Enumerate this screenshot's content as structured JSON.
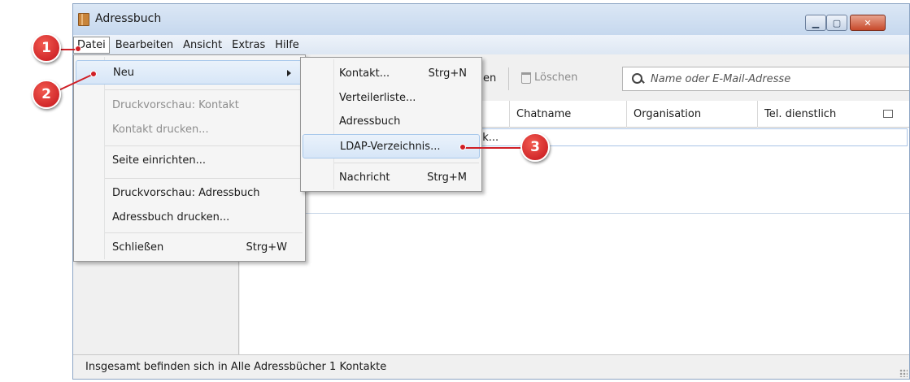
{
  "window": {
    "title": "Adressbuch",
    "controls": {
      "minimize": "▁",
      "maximize": "▢",
      "close": "✕"
    }
  },
  "menubar": [
    {
      "name": "menu-datei",
      "label": "Datei",
      "active": true
    },
    {
      "name": "menu-bearbeiten",
      "label": "Bearbeiten"
    },
    {
      "name": "menu-ansicht",
      "label": "Ansicht"
    },
    {
      "name": "menu-extras",
      "label": "Extras"
    },
    {
      "name": "menu-hilfe",
      "label": "Hilfe"
    }
  ],
  "toolbar": {
    "partial_label": "en",
    "delete_label": "Löschen",
    "search_placeholder": "Name oder E-Mail-Adresse"
  },
  "columns": [
    "Chatname",
    "Organisation",
    "Tel. dienstlich"
  ],
  "rows": [
    {
      "partial_text": "pk..."
    }
  ],
  "status": {
    "text": "Insgesamt befinden sich in Alle Adressbücher 1 Kontakte"
  },
  "datei_menu": {
    "items": [
      {
        "name": "menu-item-neu",
        "label": "Neu",
        "submenu": true,
        "highlighted": true
      },
      {
        "name": "menu-item-druckvorschau-kontakt",
        "label": "Druckvorschau: Kontakt",
        "disabled": true
      },
      {
        "name": "menu-item-kontakt-drucken",
        "label": "Kontakt drucken...",
        "disabled": true
      },
      {
        "name": "menu-item-seite-einrichten",
        "label": "Seite einrichten..."
      },
      {
        "name": "menu-item-druckvorschau-adressbuch",
        "label": "Druckvorschau: Adressbuch"
      },
      {
        "name": "menu-item-adressbuch-drucken",
        "label": "Adressbuch drucken..."
      },
      {
        "name": "menu-item-schliessen",
        "label": "Schließen",
        "shortcut": "Strg+W"
      }
    ]
  },
  "neu_submenu": {
    "items": [
      {
        "name": "submenu-item-kontakt",
        "label": "Kontakt...",
        "shortcut": "Strg+N"
      },
      {
        "name": "submenu-item-verteilerliste",
        "label": "Verteilerliste..."
      },
      {
        "name": "submenu-item-adressbuch",
        "label": "Adressbuch"
      },
      {
        "name": "submenu-item-ldap",
        "label": "LDAP-Verzeichnis...",
        "highlighted": true
      },
      {
        "name": "submenu-item-nachricht",
        "label": "Nachricht",
        "shortcut": "Strg+M"
      }
    ]
  },
  "callouts": [
    "1",
    "2",
    "3"
  ],
  "colors": {
    "callout": "#d01f26",
    "highlight": "#d7e6f7"
  }
}
